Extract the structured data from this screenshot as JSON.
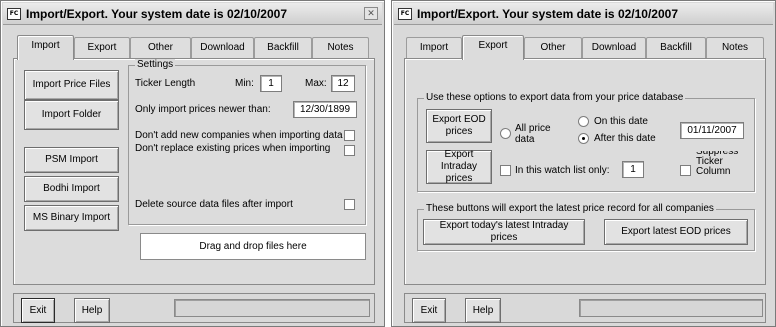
{
  "title": "Import/Export. Your system date is 02/10/2007",
  "app_icon_text": "FC",
  "close_glyph": "✕",
  "tabs": [
    "Import",
    "Export",
    "Other",
    "Download",
    "Backfill",
    "Notes"
  ],
  "import_panel": {
    "buttons": {
      "import_price_files": "Import Price Files",
      "import_folder": "Import Folder",
      "psm_import": "PSM Import",
      "bodhi_import": "Bodhi Import",
      "ms_binary_import": "MS Binary Import"
    },
    "settings": {
      "legend": "Settings",
      "ticker_length_label": "Ticker Length",
      "min_label": "Min:",
      "min_value": "1",
      "max_label": "Max:",
      "max_value": "12",
      "newer_than_label": "Only import prices newer than:",
      "newer_than_value": "12/30/1899",
      "no_add_companies": "Don't add new companies when importing data",
      "no_replace_prices": "Don't replace existing prices when importing",
      "delete_source": "Delete source data files after import"
    },
    "dropzone": "Drag and drop files here"
  },
  "export_panel": {
    "group1_legend": "Use these options to export data from your price database",
    "export_eod": "Export EOD prices",
    "export_intraday": "Export Intraday prices",
    "all_price_data": "All price data",
    "on_this_date": "On this date",
    "after_this_date": "After this date",
    "date_value": "01/11/2007",
    "watch_list_label": "In this watch list only:",
    "watch_list_value": "1",
    "suppress_ticker": "Suppress Ticker Column",
    "group2_legend": "These buttons will export the latest price record for all companies",
    "export_latest_intraday": "Export today's latest Intraday prices",
    "export_latest_eod": "Export latest EOD prices"
  },
  "footer": {
    "exit": "Exit",
    "help": "Help"
  }
}
